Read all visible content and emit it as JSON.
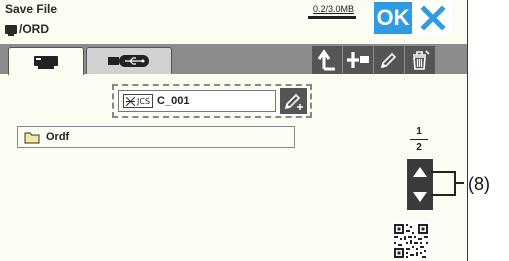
{
  "header": {
    "title": "Save File",
    "path": "/ORD",
    "capacity": "0.2/3.0MB",
    "ok_label": "OK"
  },
  "tabs": [
    {
      "name": "machine",
      "icon": "machine-icon",
      "selected": true
    },
    {
      "name": "usb",
      "icon": "usb-icon",
      "selected": false
    }
  ],
  "toolbar": [
    "up-folder-icon",
    "new-folder-icon",
    "pencil-icon",
    "trash-icon"
  ],
  "file": {
    "badge": "JCS",
    "name": "C_001"
  },
  "folders": [
    {
      "label": "Ordf"
    }
  ],
  "pager": {
    "current": "1",
    "total": "2"
  },
  "callout": "(8)",
  "colors": {
    "accent": "#2f9be2",
    "tabbar": "#8c8c8c",
    "screen": "#fbfcf2",
    "button": "#555555"
  }
}
